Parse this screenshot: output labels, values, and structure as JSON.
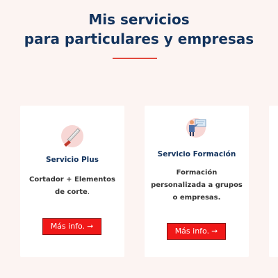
{
  "section": {
    "title_line1": "Mis servicios",
    "title_line2": "para particulares y empresas"
  },
  "colors": {
    "title": "#13335d",
    "accent": "#e2483e",
    "button": "#f01818",
    "background": "#fcf4f2",
    "card": "#ffffff"
  },
  "cards": [
    {
      "icon": "knife-icon",
      "title": "Servicio Plus",
      "description_line1": "Cortador + Elementos",
      "description_line2": "de corte",
      "description_end": ".",
      "button_label": "Más info.",
      "button_arrow": "➞"
    },
    {
      "icon": "presenter-icon",
      "title": "Servicio Formación",
      "description_line1": "Formación",
      "description_line2": "personalizada a grupos",
      "description_line3": "o empresas.",
      "button_label": "Más info.",
      "button_arrow": "➞"
    }
  ]
}
